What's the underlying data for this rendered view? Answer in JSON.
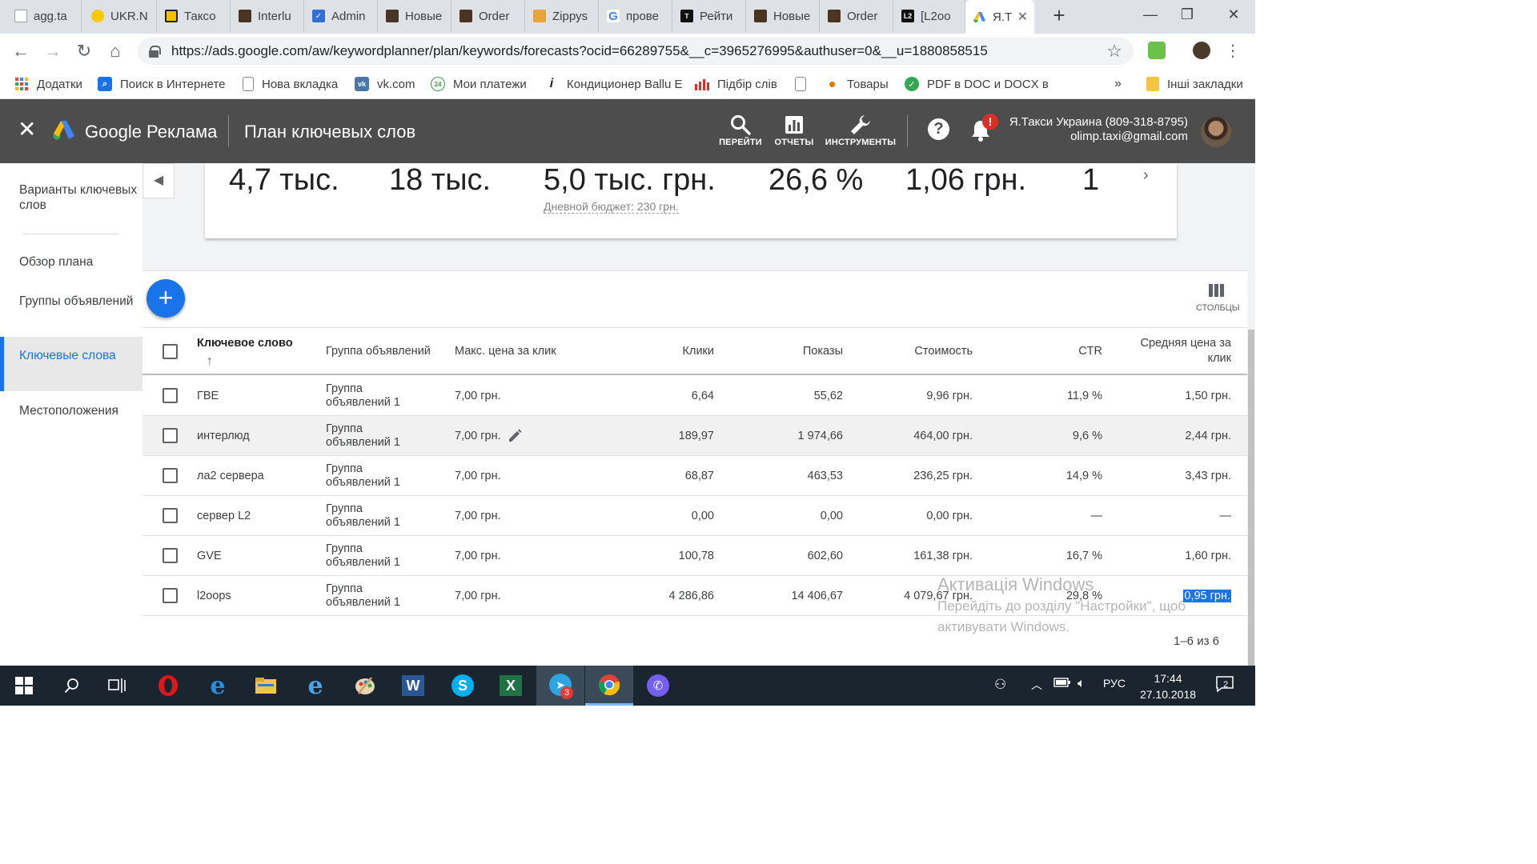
{
  "browser": {
    "tabs": [
      {
        "label": "agg.ta",
        "icon": "document-icon"
      },
      {
        "label": "UKR.N",
        "icon": "ukrnet-icon"
      },
      {
        "label": "Таксо",
        "icon": "taxi-icon"
      },
      {
        "label": "Interlu",
        "icon": "site-icon"
      },
      {
        "label": "Admin",
        "icon": "admin-icon"
      },
      {
        "label": "Новые",
        "icon": "site-icon"
      },
      {
        "label": "Order",
        "icon": "site-icon"
      },
      {
        "label": "Zippys",
        "icon": "zippy-icon"
      },
      {
        "label": "прове",
        "icon": "google-icon"
      },
      {
        "label": "Рейти",
        "icon": "top-icon"
      },
      {
        "label": "Новые",
        "icon": "site-icon"
      },
      {
        "label": "Order",
        "icon": "site-icon"
      },
      {
        "label": "[L2oo",
        "icon": "l2-icon"
      },
      {
        "label": "Я.Т",
        "icon": "google-ads-icon"
      }
    ],
    "url": "https://ads.google.com/aw/keywordplanner/plan/keywords/forecasts?ocid=66289755&__c=3965276995&authuser=0&__u=1880858515",
    "bookmarks": [
      {
        "label": "Додатки",
        "icon": "apps-icon"
      },
      {
        "label": "Поиск в Интернете",
        "icon": "search-icon"
      },
      {
        "label": "Нова вкладка",
        "icon": "document-icon"
      },
      {
        "label": "vk.com",
        "icon": "vk-icon"
      },
      {
        "label": "Мои платежи",
        "icon": "payments-icon"
      },
      {
        "label": "Кондиционер Ballu E",
        "icon": "info-icon"
      },
      {
        "label": "Підбір слів",
        "icon": "bar-chart-icon"
      },
      {
        "label": "",
        "icon": "document-icon"
      },
      {
        "label": "Товары",
        "icon": "dot-icon"
      },
      {
        "label": "PDF в DOC и DOCX в",
        "icon": "pdf-icon"
      }
    ],
    "bookmarks_more": "»",
    "other_bookmarks": "Інші закладки"
  },
  "header": {
    "brand": "Google Реклама",
    "page_title": "План ключевых слов",
    "nav": [
      {
        "label": "ПЕРЕЙТИ",
        "icon": "search-icon"
      },
      {
        "label": "ОТЧЕТЫ",
        "icon": "reports-icon"
      },
      {
        "label": "ИНСТРУМЕНТЫ",
        "icon": "wrench-icon"
      }
    ],
    "help_icon": "?",
    "notification_badge": "!",
    "account_name": "Я.Такси Украина (809-318-8795)",
    "account_email": "olimp.taxi@gmail.com"
  },
  "sidebar": {
    "items": [
      {
        "label": "Варианты ключевых слов",
        "active": false
      },
      {
        "label": "Обзор плана",
        "active": false
      },
      {
        "label": "Группы объявлений",
        "active": false
      },
      {
        "label": "Ключевые слова",
        "active": true
      },
      {
        "label": "Местоположения",
        "active": false
      }
    ]
  },
  "summary": {
    "metrics": [
      "4,7 тыс.",
      "18 тыс.",
      "5,0 тыс. грн.",
      "26,6 %",
      "1,06 грн.",
      "1"
    ],
    "budget_label": "Дневной бюджет: 230 грн."
  },
  "table": {
    "add_label": "+",
    "columns_label": "СТОЛБЦЫ",
    "headers": {
      "keyword": "Ключевое слово",
      "ad_group": "Группа объявлений",
      "max_cpc": "Макс. цена за клик",
      "clicks": "Клики",
      "impressions": "Показы",
      "cost": "Стоимость",
      "ctr": "CTR",
      "avg_cpc": "Средняя цена за клик"
    },
    "rows": [
      {
        "keyword": "ГВЕ",
        "ad_group": "Группа объявлений 1",
        "max_cpc": "7,00 грн.",
        "clicks": "6,64",
        "impressions": "55,62",
        "cost": "9,96 грн.",
        "ctr": "11,9 %",
        "avg_cpc": "1,50 грн."
      },
      {
        "keyword": "интерлюд",
        "ad_group": "Группа объявлений 1",
        "max_cpc": "7,00 грн.",
        "clicks": "189,97",
        "impressions": "1 974,66",
        "cost": "464,00 грн.",
        "ctr": "9,6 %",
        "avg_cpc": "2,44 грн."
      },
      {
        "keyword": "ла2 сервера",
        "ad_group": "Группа объявлений 1",
        "max_cpc": "7,00 грн.",
        "clicks": "68,87",
        "impressions": "463,53",
        "cost": "236,25 грн.",
        "ctr": "14,9 %",
        "avg_cpc": "3,43 грн."
      },
      {
        "keyword": "сервер L2",
        "ad_group": "Группа объявлений 1",
        "max_cpc": "7,00 грн.",
        "clicks": "0,00",
        "impressions": "0,00",
        "cost": "0,00 грн.",
        "ctr": "—",
        "avg_cpc": "—"
      },
      {
        "keyword": "GVE",
        "ad_group": "Группа объявлений 1",
        "max_cpc": "7,00 грн.",
        "clicks": "100,78",
        "impressions": "602,60",
        "cost": "161,38 грн.",
        "ctr": "16,7 %",
        "avg_cpc": "1,60 грн."
      },
      {
        "keyword": "l2oops",
        "ad_group": "Группа объявлений 1",
        "max_cpc": "7,00 грн.",
        "clicks": "4 286,86",
        "impressions": "14 406,67",
        "cost": "4 079,67 грн.",
        "ctr": "29,8 %",
        "avg_cpc": "0,95 грн."
      }
    ],
    "pagination": "1–6 из 6"
  },
  "watermark": {
    "line1": "Активація Windows",
    "line2": "Перейдіть до розділу \"Настройки\", щоб",
    "line3": "активувати Windows."
  },
  "taskbar": {
    "telegram_badge": "3",
    "language": "РУС",
    "time": "17:44",
    "date": "27.10.2018",
    "notifications": "2"
  },
  "colors": {
    "accent": "#1a73e8",
    "header_bg": "#4d4d4d",
    "taskbar_bg": "#1b2530"
  }
}
